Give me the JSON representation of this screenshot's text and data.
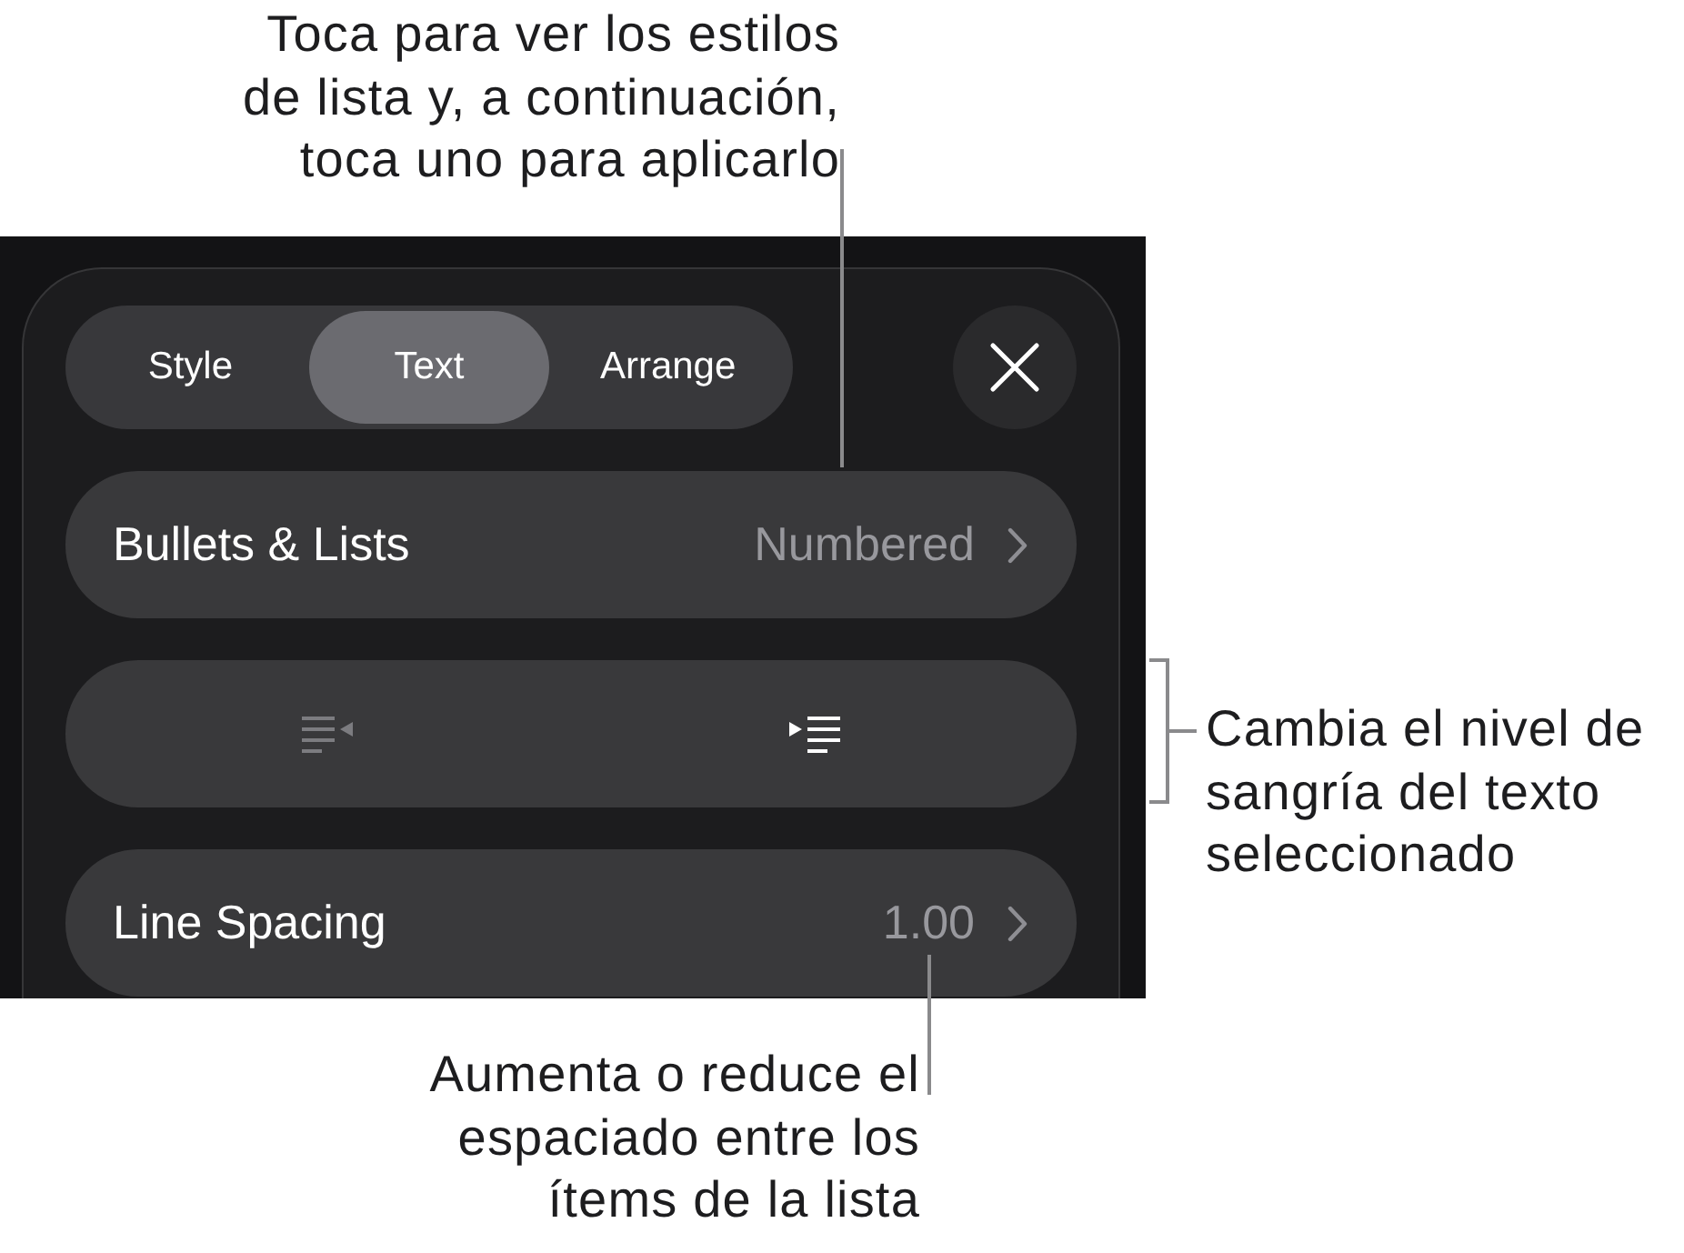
{
  "callouts": [
    {
      "kind": "above",
      "lines": [
        "Toca para ver los estilos",
        "de lista y, a continuación,",
        "toca uno para aplicarlo"
      ]
    },
    {
      "kind": "side",
      "lines": [
        "Cambia el nivel de",
        "sangría del texto",
        "seleccionado"
      ]
    },
    {
      "kind": "below",
      "lines": [
        "Aumenta o reduce el",
        "espaciado entre los",
        "ítems de la lista"
      ]
    }
  ],
  "tabs": [
    {
      "label": "Style",
      "selected": false
    },
    {
      "label": "Text",
      "selected": true
    },
    {
      "label": "Arrange",
      "selected": false
    }
  ],
  "rows": [
    {
      "kind": "disclosure",
      "label": "Bullets & Lists",
      "value": "Numbered"
    },
    {
      "kind": "indent",
      "buttons": [
        {
          "kind": "outdent",
          "disabled": true
        },
        {
          "kind": "indent",
          "disabled": false
        }
      ]
    },
    {
      "kind": "disclosure",
      "label": "Line Spacing",
      "value": "1.00"
    }
  ]
}
